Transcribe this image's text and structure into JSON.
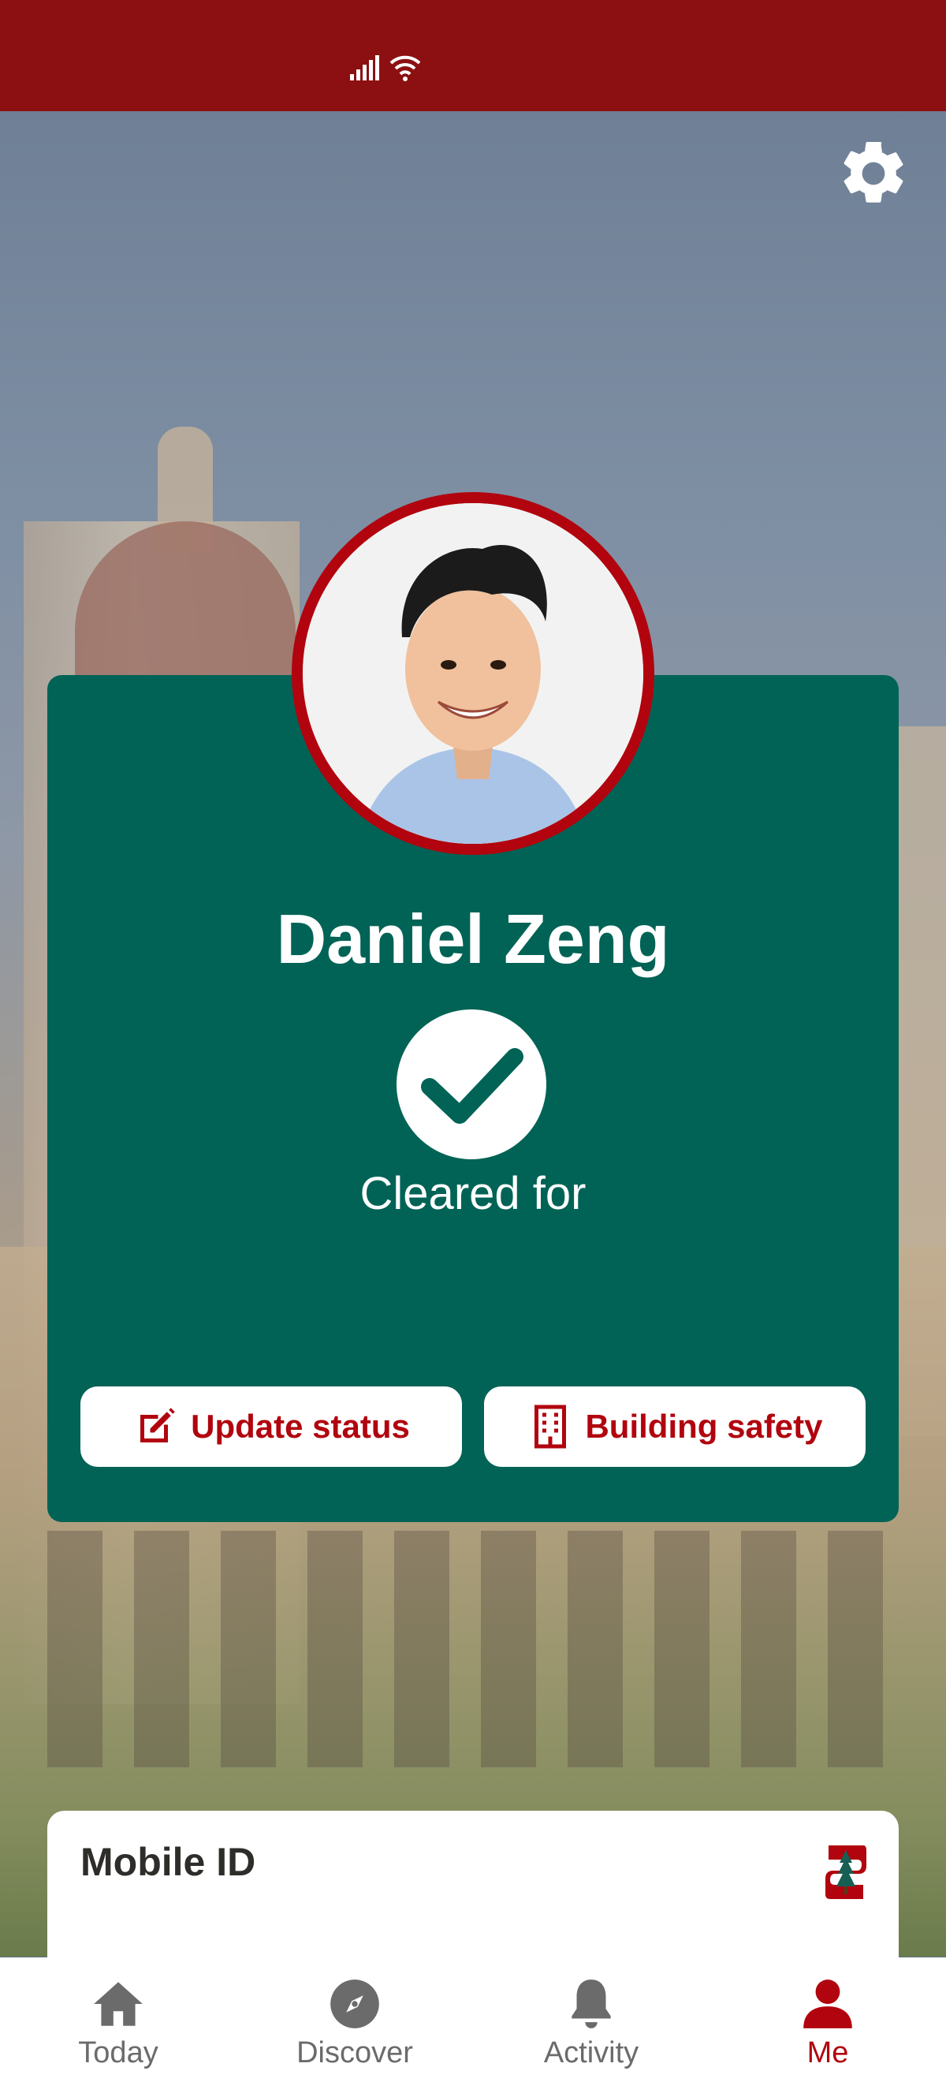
{
  "profile": {
    "name": "Daniel Zeng",
    "status": "Cleared for"
  },
  "actions": {
    "update_status": "Update status",
    "building_safety": "Building safety"
  },
  "mobile_id": {
    "label": "Mobile ID"
  },
  "nav": {
    "items": [
      {
        "label": "Today",
        "icon": "home-icon"
      },
      {
        "label": "Discover",
        "icon": "compass-icon"
      },
      {
        "label": "Activity",
        "icon": "bell-icon"
      },
      {
        "label": "Me",
        "icon": "person-icon"
      }
    ],
    "active": "Me"
  },
  "colors": {
    "brand_red": "#8c1011",
    "accent_red": "#b1040e",
    "card_green": "#006356"
  }
}
